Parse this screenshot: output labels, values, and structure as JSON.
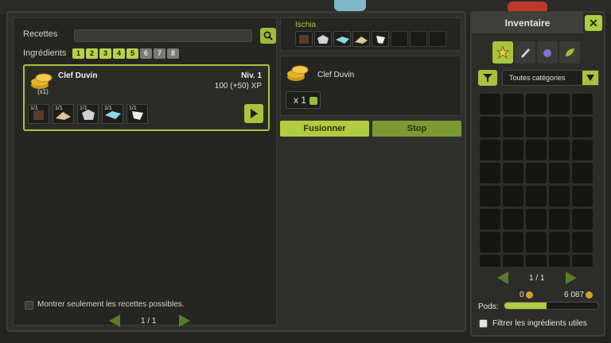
{
  "crafting": {
    "recipes_label": "Recettes",
    "search_placeholder": "",
    "ingredients_label": "Ingrédients",
    "ingredient_counts": [
      "1",
      "2",
      "3",
      "4",
      "5",
      "6",
      "7",
      "8"
    ],
    "recipe": {
      "name": "Clef Duvin",
      "qty": "(x1)",
      "level": "Niv. 1",
      "xp": "100 (+50) XP",
      "ingredients": [
        "1/1",
        "1/1",
        "1/1",
        "1/1",
        "1/1"
      ]
    },
    "show_possible_label": "Montrer seulement les recettes possibles.",
    "pager": "1 / 1"
  },
  "fusion": {
    "zone_name": "Ischia",
    "result_name": "Clef Duvin",
    "result_qty": "x 1",
    "fuse_label": "Fusionner",
    "stop_label": "Stop"
  },
  "inventory": {
    "title": "Inventaire",
    "close_label": "✕",
    "category": "Toutes catégories",
    "pager": "1 / 1",
    "kamas_left": "0",
    "kamas_right": "6 087",
    "pods_label": "Pods:",
    "pods_fraction": 0.45,
    "filter_label": "Filtrer les ingrédients utiles"
  },
  "colors": {
    "accent": "#a8c43e",
    "panel": "#2f302c"
  }
}
